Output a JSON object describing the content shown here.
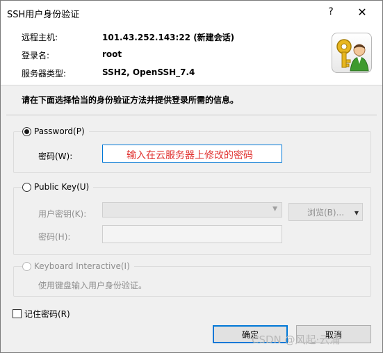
{
  "window": {
    "title": "SSH用户身份验证",
    "help_glyph": "?",
    "close_glyph": "✕"
  },
  "info": {
    "remote_host_label": "远程主机:",
    "remote_host_value": "101.43.252.143:22 (新建会话)",
    "login_label": "登录名:",
    "login_value": "root",
    "server_type_label": "服务器类型:",
    "server_type_value": "SSH2, OpenSSH_7.4",
    "icon": "key-user-icon"
  },
  "instruction": "请在下面选择恰当的身份验证方法并提供登录所需的信息。",
  "password_group": {
    "radio_label": "Password(P)",
    "selected": true,
    "password_label": "密码(W):",
    "password_value": "",
    "hint": "输入在云服务器上修改的密码"
  },
  "pubkey_group": {
    "radio_label": "Public Key(U)",
    "selected": false,
    "user_key_label": "用户密钥(K):",
    "user_key_value": "",
    "browse_label": "浏览(B)...",
    "passphrase_label": "密码(H):",
    "passphrase_value": ""
  },
  "keyboard_group": {
    "radio_label": "Keyboard Interactive(I)",
    "description": "使用键盘输入用户身份验证。"
  },
  "remember_password": {
    "label": "记住密码(R)",
    "checked": false
  },
  "buttons": {
    "ok": "确定",
    "cancel": "取消"
  },
  "watermark": "CSDN @风起·云涌"
}
